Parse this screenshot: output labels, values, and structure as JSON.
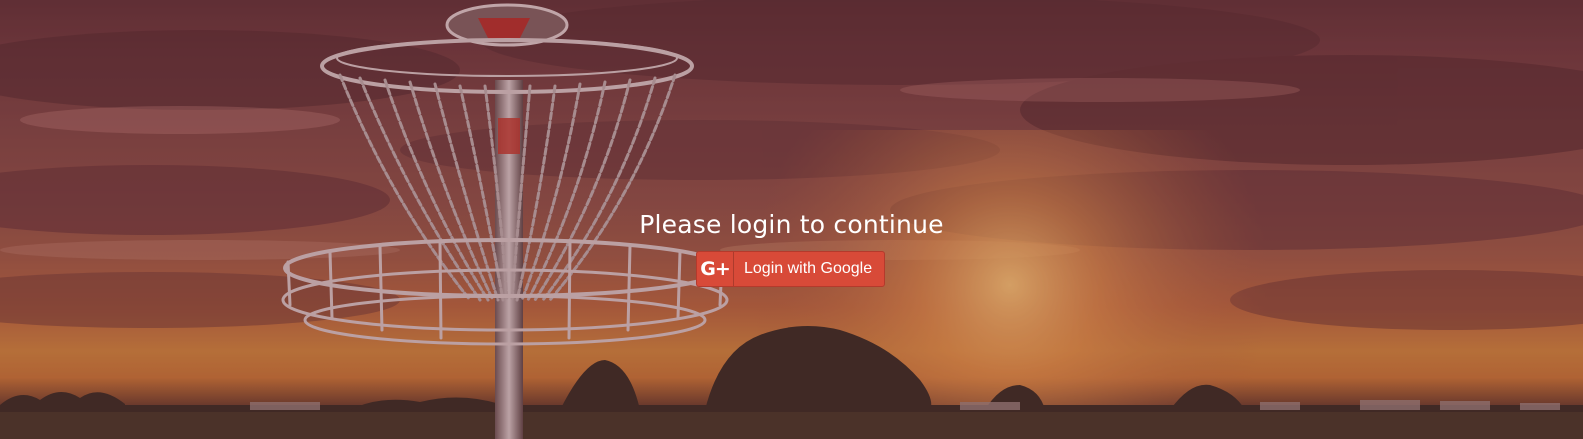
{
  "page": {
    "background_theme": "disc golf basket at sunset",
    "overlay_color": "#6e2832"
  },
  "login": {
    "title": "Please login to continue",
    "google_button": {
      "icon": "google-plus-icon",
      "icon_text": "G+",
      "label": "Login with Google",
      "color": "#d84a38"
    }
  }
}
